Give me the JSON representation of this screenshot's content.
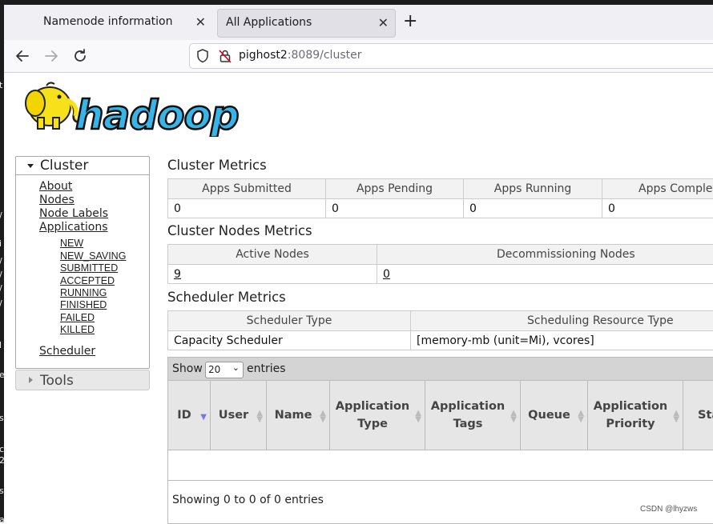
{
  "browser": {
    "tabs": [
      {
        "label": "Namenode information"
      },
      {
        "label": "All Applications"
      }
    ],
    "url": {
      "host": "pighost2",
      "rest": ":8089/cluster"
    }
  },
  "logo": {
    "text": "hadoop"
  },
  "sidebar": {
    "cluster": {
      "title": "Cluster",
      "links": [
        "About",
        "Nodes",
        "Node Labels",
        "Applications"
      ],
      "app_states": [
        "NEW",
        "NEW_SAVING",
        "SUBMITTED",
        "ACCEPTED",
        "RUNNING",
        "FINISHED",
        "FAILED",
        "KILLED"
      ],
      "scheduler": "Scheduler"
    },
    "tools": {
      "title": "Tools"
    }
  },
  "cluster_metrics": {
    "title": "Cluster Metrics",
    "headers": [
      "Apps Submitted",
      "Apps Pending",
      "Apps Running",
      "Apps Complet"
    ],
    "values": [
      "0",
      "0",
      "0",
      "0"
    ]
  },
  "nodes_metrics": {
    "title": "Cluster Nodes Metrics",
    "headers": [
      "Active Nodes",
      "Decommissioning Nodes"
    ],
    "values": [
      "9",
      "0"
    ]
  },
  "scheduler_metrics": {
    "title": "Scheduler Metrics",
    "headers": [
      "Scheduler Type",
      "Scheduling Resource Type"
    ],
    "values": [
      "Capacity Scheduler",
      "[memory-mb (unit=Mi), vcores]"
    ]
  },
  "apps_table": {
    "show_label": "Show",
    "page_size": "20",
    "entries_label": "entries",
    "columns": [
      "ID",
      "User",
      "Name",
      "Application Type",
      "Application Tags",
      "Queue",
      "Application Priority",
      "Sta"
    ],
    "footer": "Showing 0 to 0 of 0 entries"
  },
  "watermark": "CSDN @lhyzws",
  "left_window_glyphs": [
    "t",
    "/",
    "i",
    "/",
    "/",
    "/",
    "/",
    "l",
    "e",
    "s",
    "c",
    "2",
    "s",
    "a"
  ]
}
